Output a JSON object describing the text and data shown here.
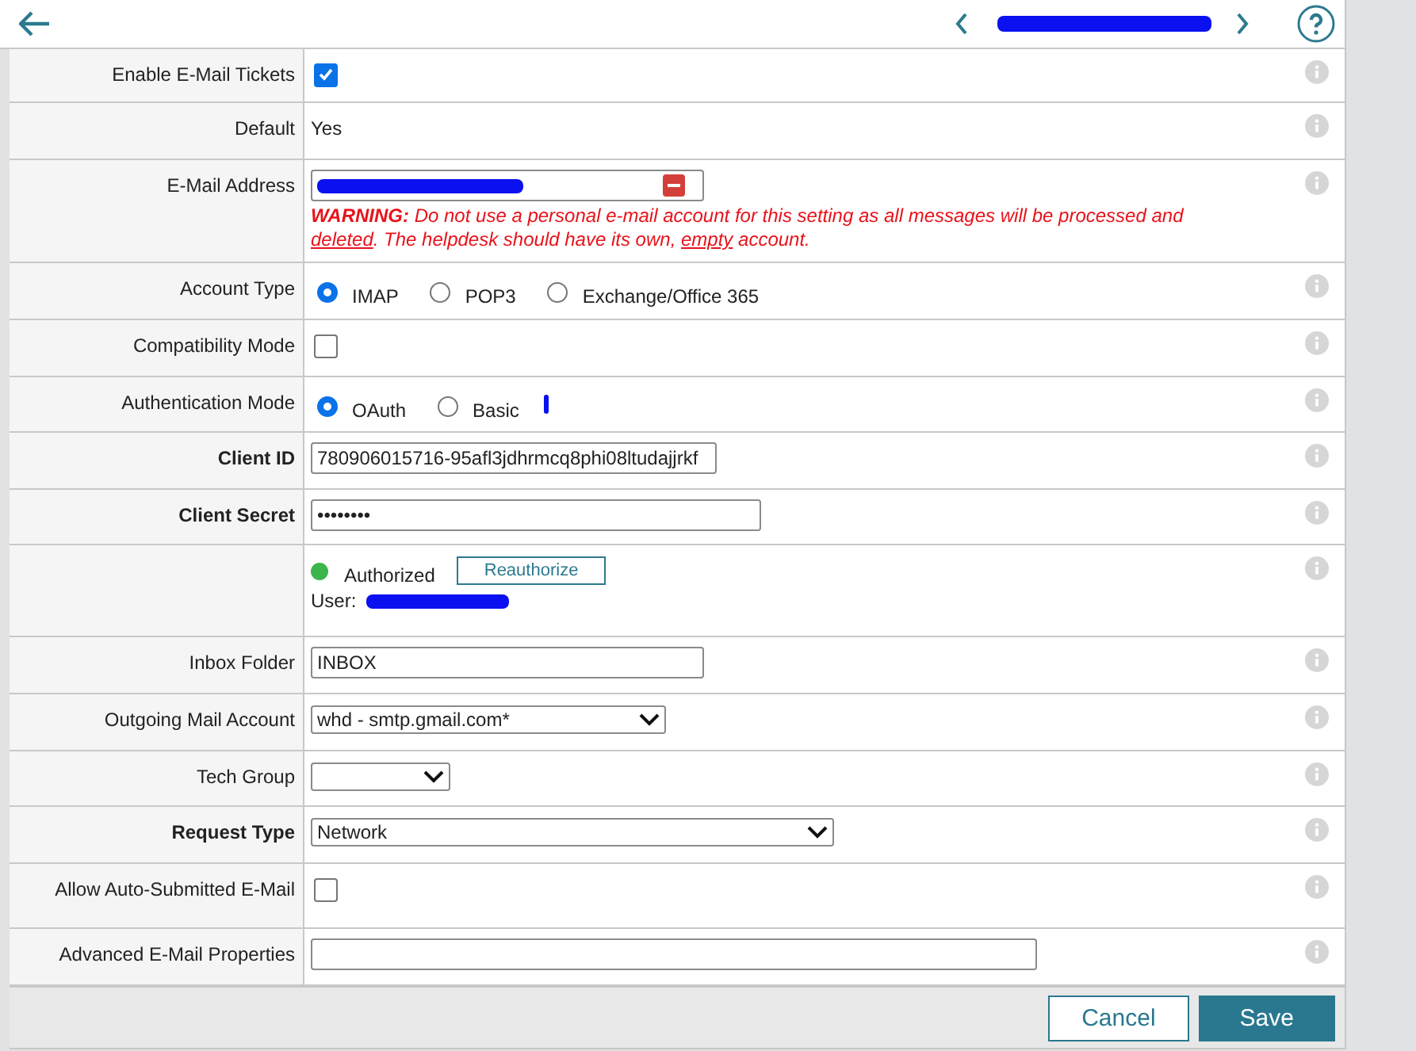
{
  "rows": [
    {
      "label": "Enable E-Mail Tickets",
      "bold": false,
      "kind": "checkbox",
      "checked": true
    },
    {
      "label": "Default",
      "bold": false,
      "kind": "text",
      "value": "Yes"
    },
    {
      "label": "E-Mail Address",
      "bold": false,
      "kind": "email",
      "warning": [
        {
          "kind": "bold",
          "text": "WARNING:"
        },
        {
          "kind": "plain",
          "text": " Do not use a personal e-mail account for this setting as all messages will be processed and "
        },
        {
          "kind": "underline",
          "text": "deleted"
        },
        {
          "kind": "plain",
          "text": ". The helpdesk should have its own, "
        },
        {
          "kind": "underline",
          "text": "empty"
        },
        {
          "kind": "plain",
          "text": " account."
        }
      ]
    },
    {
      "label": "Account Type",
      "bold": false,
      "kind": "radio",
      "options": [
        {
          "label": "IMAP",
          "selected": true
        },
        {
          "label": "POP3",
          "selected": false
        },
        {
          "label": "Exchange/Office 365",
          "selected": false
        }
      ]
    },
    {
      "label": "Compatibility Mode",
      "bold": false,
      "kind": "checkbox",
      "checked": false
    },
    {
      "label": "Authentication Mode",
      "bold": false,
      "kind": "radio",
      "options": [
        {
          "label": "OAuth",
          "selected": true
        },
        {
          "label": "Basic",
          "selected": false
        }
      ]
    },
    {
      "label": "Client ID",
      "bold": true,
      "kind": "input",
      "value": "780906015716-95afl3jdhrmcq8phi08ltudajjrkf"
    },
    {
      "label": "Client Secret",
      "bold": true,
      "kind": "input",
      "value": "••••••••"
    },
    {
      "kind": "auth",
      "status": "Authorized",
      "color": "#3cb54a",
      "button": "Reauthorize",
      "user_label": "User:"
    },
    {
      "label": "Inbox Folder",
      "bold": false,
      "kind": "input",
      "value": "INBOX"
    },
    {
      "label": "Outgoing Mail Account",
      "bold": false,
      "kind": "select",
      "value": "whd - smtp.gmail.com*"
    },
    {
      "label": "Tech Group",
      "bold": false,
      "kind": "select",
      "value": ""
    },
    {
      "label": "Request Type",
      "bold": true,
      "kind": "select",
      "value": "Network"
    },
    {
      "label": "Allow Auto-Submitted E-Mail",
      "bold": false,
      "kind": "checkbox",
      "checked": false
    },
    {
      "label": "Advanced E-Mail Properties",
      "bold": false,
      "kind": "input",
      "value": ""
    }
  ],
  "buttons": [
    {
      "label": "Cancel",
      "kind": "secondary"
    },
    {
      "label": "Save",
      "kind": "primary"
    }
  ]
}
